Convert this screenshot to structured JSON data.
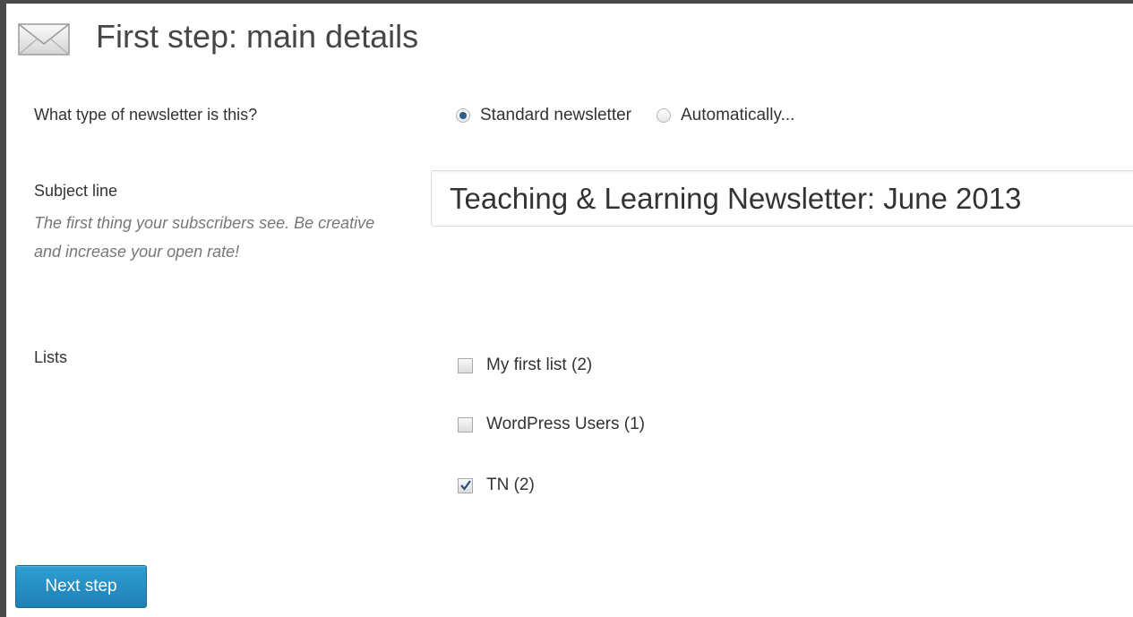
{
  "header": {
    "title": "First step: main details",
    "icon": "envelope-icon"
  },
  "newsletter_type": {
    "label": "What type of newsletter is this?",
    "options": [
      {
        "label": "Standard newsletter",
        "checked": true
      },
      {
        "label": "Automatically...",
        "checked": false
      }
    ]
  },
  "subject": {
    "label": "Subject line",
    "hint": "The first thing your subscribers see. Be creative and increase your open rate!",
    "value": "Teaching & Learning Newsletter: June 2013"
  },
  "lists": {
    "label": "Lists",
    "items": [
      {
        "label": "My first list (2)",
        "checked": false
      },
      {
        "label": "WordPress Users (1)",
        "checked": false
      },
      {
        "label": "TN (2)",
        "checked": true
      }
    ]
  },
  "actions": {
    "next_label": "Next step"
  },
  "colors": {
    "button": "#2a95c5",
    "radio_dot": "#2b5d8c",
    "hint_text": "#777777"
  }
}
